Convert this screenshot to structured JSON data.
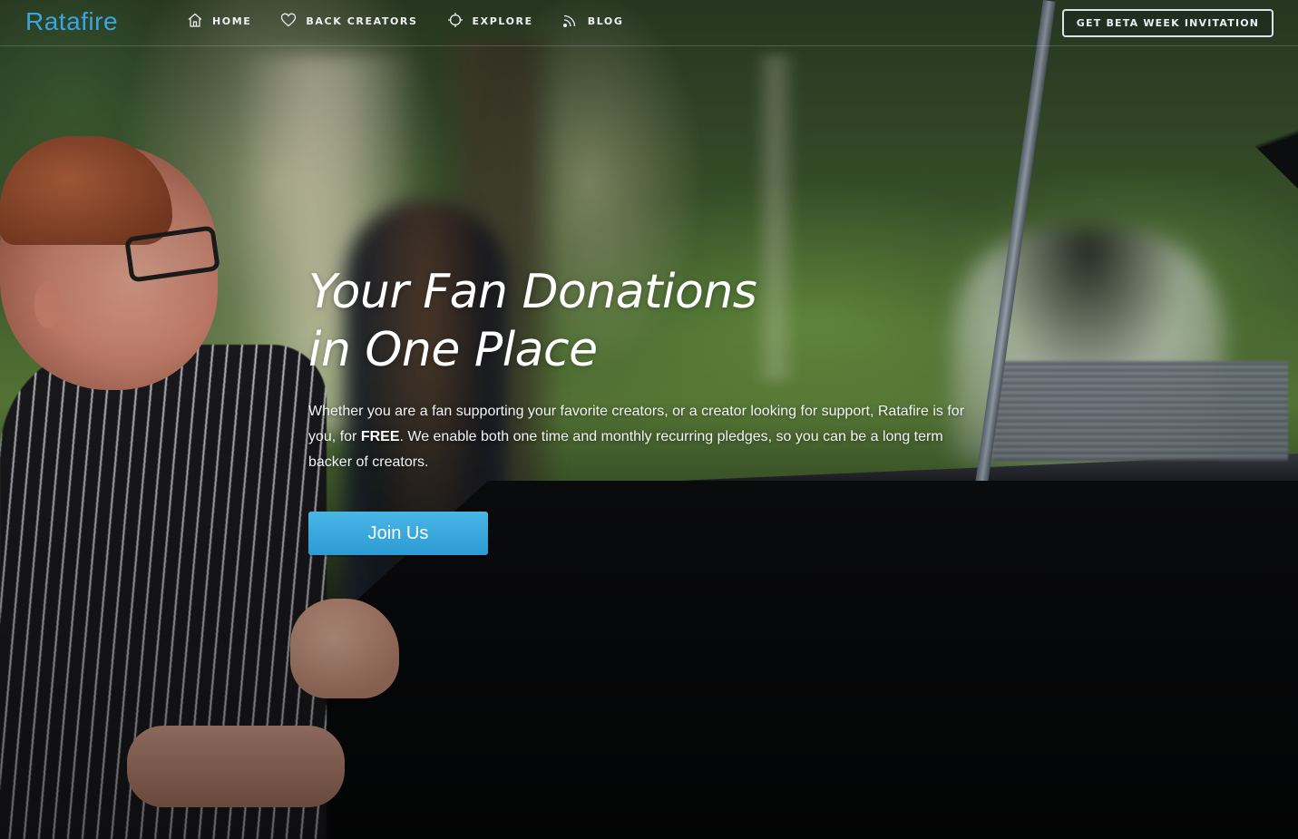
{
  "brand": {
    "name": "Ratafire",
    "color": "#3aa6e0"
  },
  "nav": {
    "items": [
      {
        "label": "HOME",
        "icon": "home-icon"
      },
      {
        "label": "BACK CREATORS",
        "icon": "heart-icon"
      },
      {
        "label": "EXPLORE",
        "icon": "crosshair-icon"
      },
      {
        "label": "BLOG",
        "icon": "rss-icon"
      }
    ],
    "cta_label": "GET BETA WEEK INVITATION"
  },
  "hero": {
    "title_line1": "Your Fan Donations",
    "title_line2": "in One Place",
    "text_before_bold": "Whether you are a fan supporting your favorite creators, or a creator looking for support, Ratafire is for you, for ",
    "text_bold": "FREE",
    "text_after_bold": ". We enable both one time and monthly recurring pledges, so you can be a long term backer of creators.",
    "button_label": "Join Us",
    "button_color": "#34a4da"
  }
}
